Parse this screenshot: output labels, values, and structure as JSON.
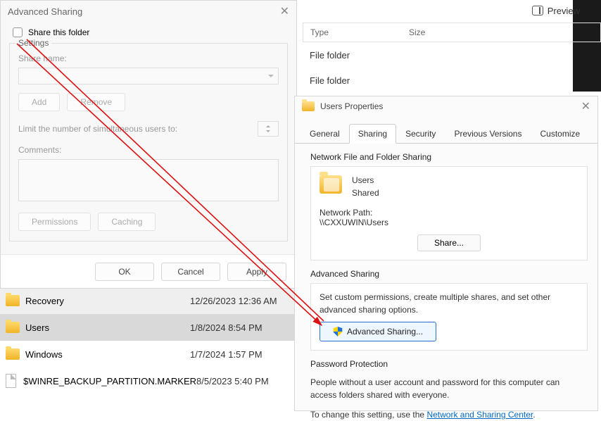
{
  "explorer": {
    "preview_label": "Preview",
    "col_type": "Type",
    "col_size": "Size",
    "row1_type": "File folder",
    "row2_type": "File folder",
    "rows": [
      {
        "name": "Recovery",
        "date": "12/26/2023 12:36 AM"
      },
      {
        "name": "Users",
        "date": "1/8/2024 8:54 PM"
      },
      {
        "name": "Windows",
        "date": "1/7/2024 1:57 PM"
      },
      {
        "name": "$WINRE_BACKUP_PARTITION.MARKER",
        "date": "8/5/2023 5:40 PM"
      }
    ]
  },
  "advanced_sharing": {
    "title": "Advanced Sharing",
    "share_checkbox_label": "Share this folder",
    "group_legend": "Settings",
    "share_name_label": "Share name:",
    "add_label": "Add",
    "remove_label": "Remove",
    "limit_label": "Limit the number of simultaneous users to:",
    "comments_label": "Comments:",
    "permissions_label": "Permissions",
    "caching_label": "Caching",
    "ok_label": "OK",
    "cancel_label": "Cancel",
    "apply_label": "Apply"
  },
  "properties": {
    "title": "Users Properties",
    "tabs": {
      "general": "General",
      "sharing": "Sharing",
      "security": "Security",
      "previous": "Previous Versions",
      "customize": "Customize"
    },
    "nfs_title": "Network File and Folder Sharing",
    "folder_name": "Users",
    "shared_status": "Shared",
    "network_path_label": "Network Path:",
    "network_path_value": "\\\\CXXUWIN\\Users",
    "share_button": "Share...",
    "adv_title": "Advanced Sharing",
    "adv_desc": "Set custom permissions, create multiple shares, and set other advanced sharing options.",
    "adv_button": "Advanced Sharing...",
    "pp_title": "Password Protection",
    "pp_desc": "People without a user account and password for this computer can access folders shared with everyone.",
    "pp_change_prefix": "To change this setting, use the ",
    "pp_link": "Network and Sharing Center",
    "pp_change_suffix": "."
  }
}
